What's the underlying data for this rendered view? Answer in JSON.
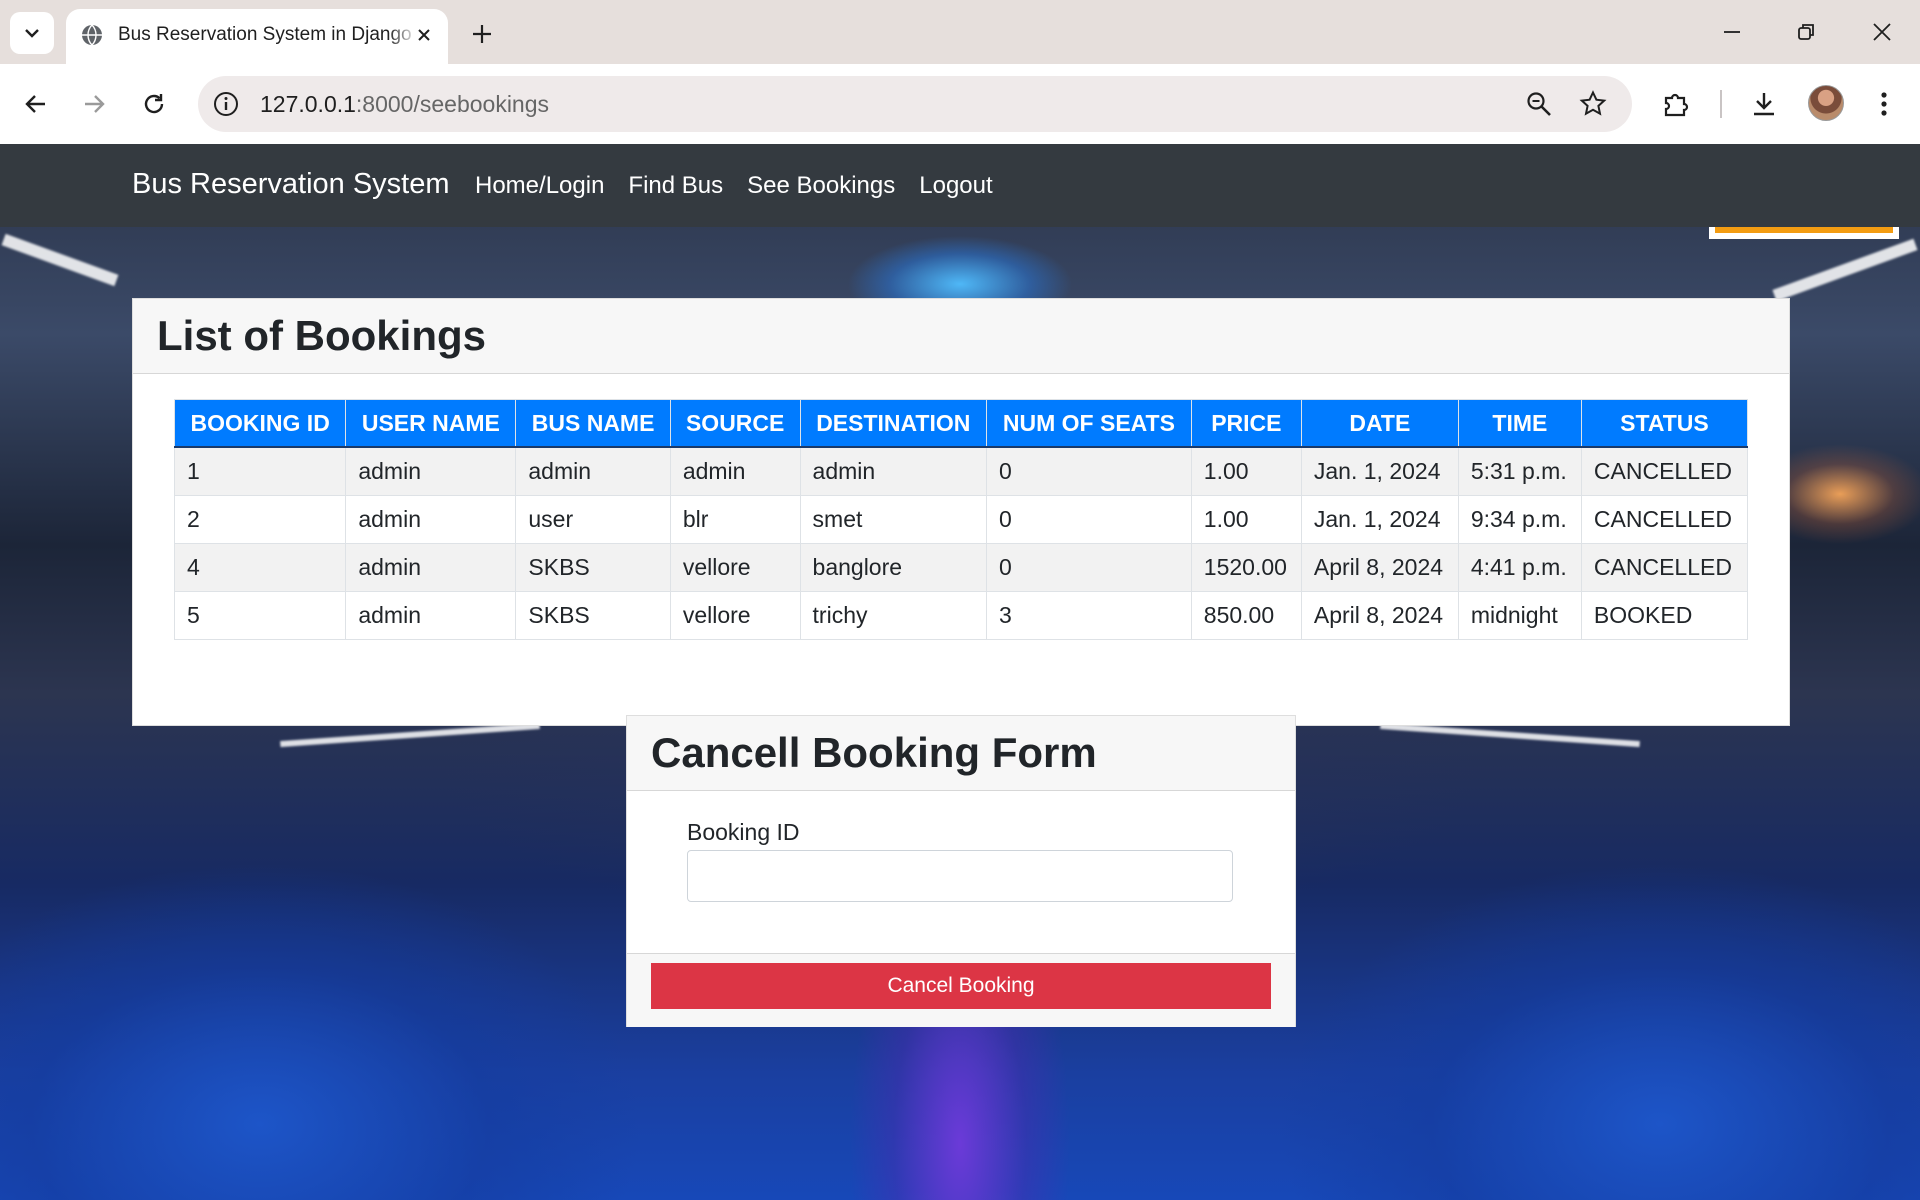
{
  "browser": {
    "tab_title": "Bus Reservation System in Django",
    "url_host": "127.0.0.1",
    "url_path": ":8000/seebookings"
  },
  "navbar": {
    "brand": "Bus Reservation System",
    "links": [
      "Home/Login",
      "Find Bus",
      "See Bookings",
      "Logout"
    ]
  },
  "bookings": {
    "title": "List of Bookings",
    "columns": [
      "BOOKING ID",
      "USER NAME",
      "BUS NAME",
      "SOURCE",
      "DESTINATION",
      "NUM OF SEATS",
      "PRICE",
      "DATE",
      "TIME",
      "STATUS"
    ],
    "rows": [
      [
        "1",
        "admin",
        "admin",
        "admin",
        "admin",
        "0",
        "1.00",
        "Jan. 1, 2024",
        "5:31 p.m.",
        "CANCELLED"
      ],
      [
        "2",
        "admin",
        "user",
        "blr",
        "smet",
        "0",
        "1.00",
        "Jan. 1, 2024",
        "9:34 p.m.",
        "CANCELLED"
      ],
      [
        "4",
        "admin",
        "SKBS",
        "vellore",
        "banglore",
        "0",
        "1520.00",
        "April 8, 2024",
        "4:41 p.m.",
        "CANCELLED"
      ],
      [
        "5",
        "admin",
        "SKBS",
        "vellore",
        "trichy",
        "3",
        "850.00",
        "April 8, 2024",
        "midnight",
        "BOOKED"
      ]
    ]
  },
  "cancel_form": {
    "title": "Cancell Booking Form",
    "field_label": "Booking ID",
    "field_value": "",
    "button_label": "Cancel Booking"
  },
  "colors": {
    "navbar": "#343a40",
    "table_header": "#007bff",
    "danger": "#dc3545"
  }
}
